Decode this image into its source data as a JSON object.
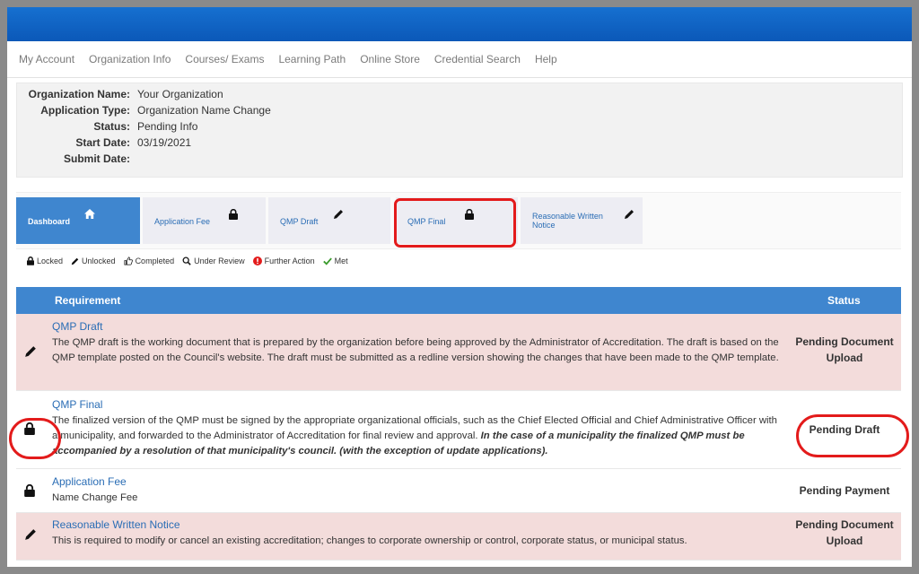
{
  "nav": {
    "items": [
      "My Account",
      "Organization Info",
      "Courses/ Exams",
      "Learning Path",
      "Online Store",
      "Credential Search",
      "Help"
    ]
  },
  "info": {
    "org_name_label": "Organization Name:",
    "org_name_value": "Your Organization",
    "app_type_label": "Application Type:",
    "app_type_value": "Organization Name Change",
    "status_label": "Status:",
    "status_value": "Pending Info",
    "start_label": "Start Date:",
    "start_value": "03/19/2021",
    "submit_label": "Submit Date:",
    "submit_value": ""
  },
  "tabs": [
    {
      "label": "Dashboard",
      "icon": "home-icon"
    },
    {
      "label": "Application Fee",
      "icon": "lock-icon"
    },
    {
      "label": "QMP Draft",
      "icon": "pencil-icon"
    },
    {
      "label": "QMP Final",
      "icon": "lock-icon"
    },
    {
      "label": "Reasonable Written Notice",
      "icon": "pencil-icon"
    }
  ],
  "legend": {
    "locked": "Locked",
    "unlocked": "Unlocked",
    "completed": "Completed",
    "under_review": "Under Review",
    "further_action": "Further Action",
    "met": "Met",
    "colors": {
      "further_action": "#e31b1b",
      "met": "#3a9b2c"
    }
  },
  "table": {
    "header": {
      "requirement": "Requirement",
      "status": "Status"
    },
    "rows": [
      {
        "title": "QMP Draft",
        "icon": "pencil-icon",
        "desc": "The QMP draft is the working document that is prepared by the organization before being approved by the Administrator of Accreditation. The draft is based on the QMP template posted on the Council's website. The draft must be submitted as a redline version showing the changes that have been made to the QMP template.",
        "status": "Pending Document Upload"
      },
      {
        "title": "QMP Final",
        "icon": "lock-icon",
        "desc": "The finalized version of the QMP must be signed by the appropriate organizational officials, such as the Chief Elected Official and Chief Administrative Officer with a municipality, and forwarded to the Administrator of Accreditation for final review and approval.",
        "desc_bold": "In the case of a municipality the finalized QMP must be accompanied by a resolution of that municipality's council. (with the exception of update applications).",
        "status": "Pending Draft"
      },
      {
        "title": "Application Fee",
        "icon": "lock-icon",
        "desc": "Name Change Fee",
        "status": "Pending Payment"
      },
      {
        "title": "Reasonable Written Notice",
        "icon": "pencil-icon",
        "desc": "This is required to modify or cancel an existing accreditation; changes to corporate ownership or control, corporate status, or municipal status.",
        "status": "Pending Document Upload"
      }
    ]
  },
  "colors": {
    "topbar": "#0b58b8",
    "accent": "#3f86cf",
    "link": "#2a6db5",
    "row_highlight": "#f3dcdb",
    "annotation": "#e31b1b"
  }
}
